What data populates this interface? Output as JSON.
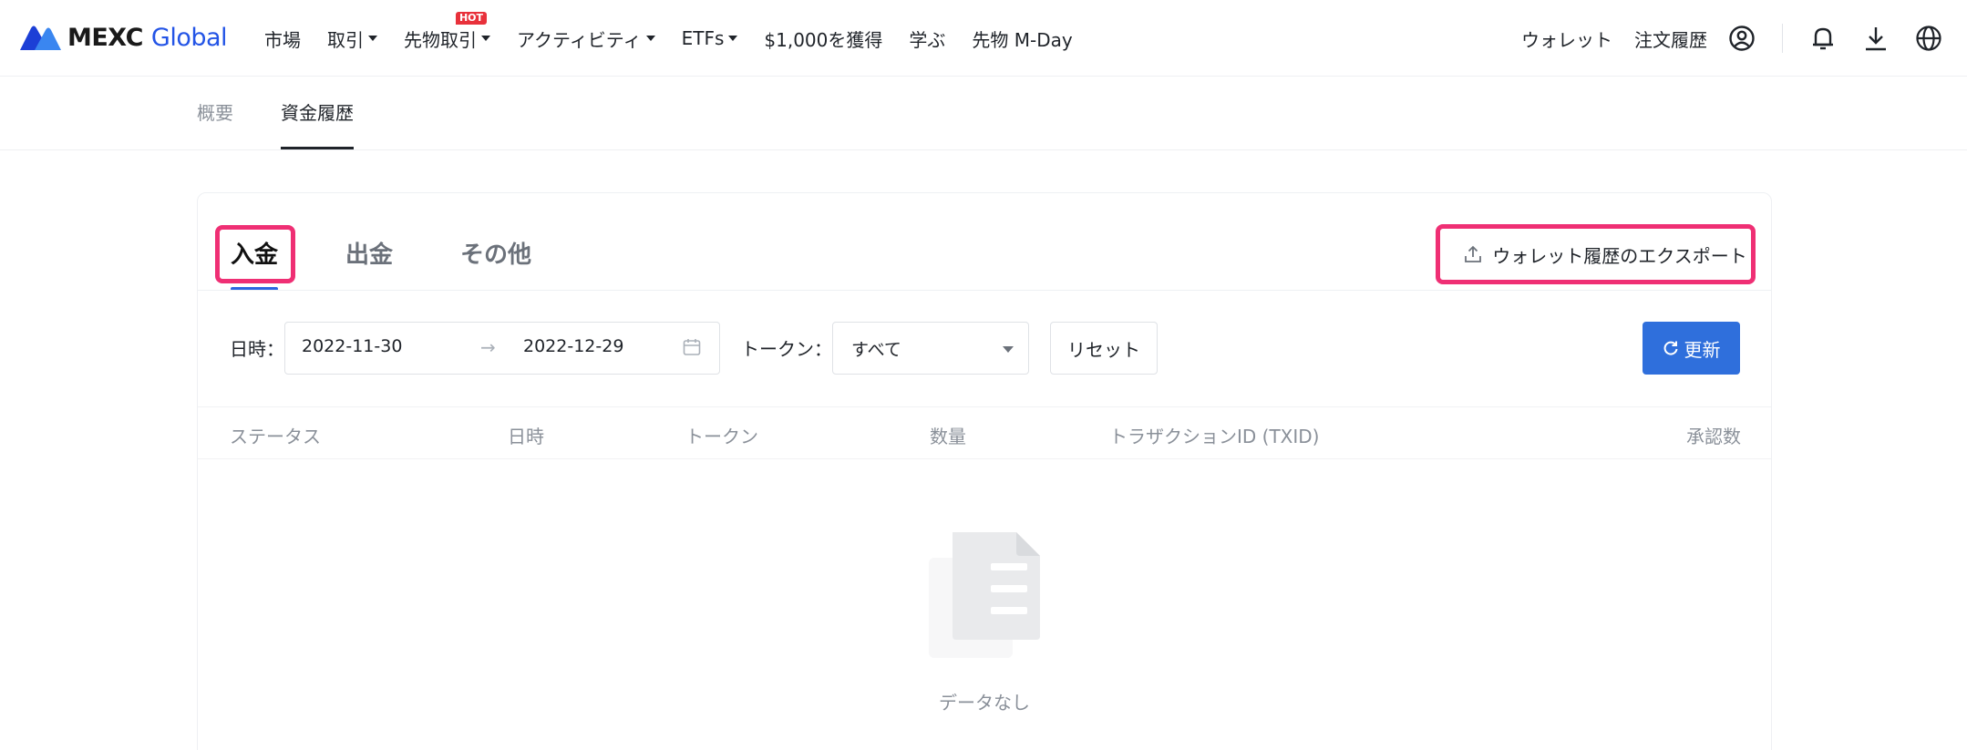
{
  "brand": {
    "name_part1": "MEXC",
    "name_part2": "Global"
  },
  "nav": {
    "items": [
      {
        "label": "市場",
        "dropdown": false
      },
      {
        "label": "取引",
        "dropdown": true
      },
      {
        "label": "先物取引",
        "dropdown": true,
        "badge": "HOT"
      },
      {
        "label": "アクティビティ",
        "dropdown": true
      },
      {
        "label": "ETFs",
        "dropdown": true
      },
      {
        "label": "$1,000を獲得",
        "dropdown": false
      },
      {
        "label": "学ぶ",
        "dropdown": false
      },
      {
        "label": "先物 M-Day",
        "dropdown": false
      }
    ],
    "right": {
      "wallet": "ウォレット",
      "order_history": "注文履歴",
      "icons": [
        "user-circle-icon",
        "bell-icon",
        "download-icon",
        "globe-icon"
      ]
    }
  },
  "subtabs": {
    "overview": "概要",
    "fund_history": "資金履歴",
    "active": "資金履歴"
  },
  "main_tabs": {
    "deposit": "入金",
    "withdraw": "出金",
    "other": "その他",
    "active": "入金"
  },
  "export": {
    "label": "ウォレット履歴のエクスポート",
    "icon": "upload-icon"
  },
  "filters": {
    "date_label": "日時：",
    "date_start": "2022-11-30",
    "date_end": "2022-12-29",
    "token_label": "トークン：",
    "token_value": "すべて",
    "reset_label": "リセット",
    "refresh_label": "更新"
  },
  "table": {
    "columns": [
      "ステータス",
      "日時",
      "トークン",
      "数量",
      "トラザクションID (TXID)",
      "承認数"
    ],
    "rows": []
  },
  "empty_state": {
    "text": "データなし"
  },
  "colors": {
    "accent": "#2f6fdc",
    "highlight": "#ef2f74",
    "hot": "#e8313b",
    "brand_blue": "#2354e6"
  }
}
